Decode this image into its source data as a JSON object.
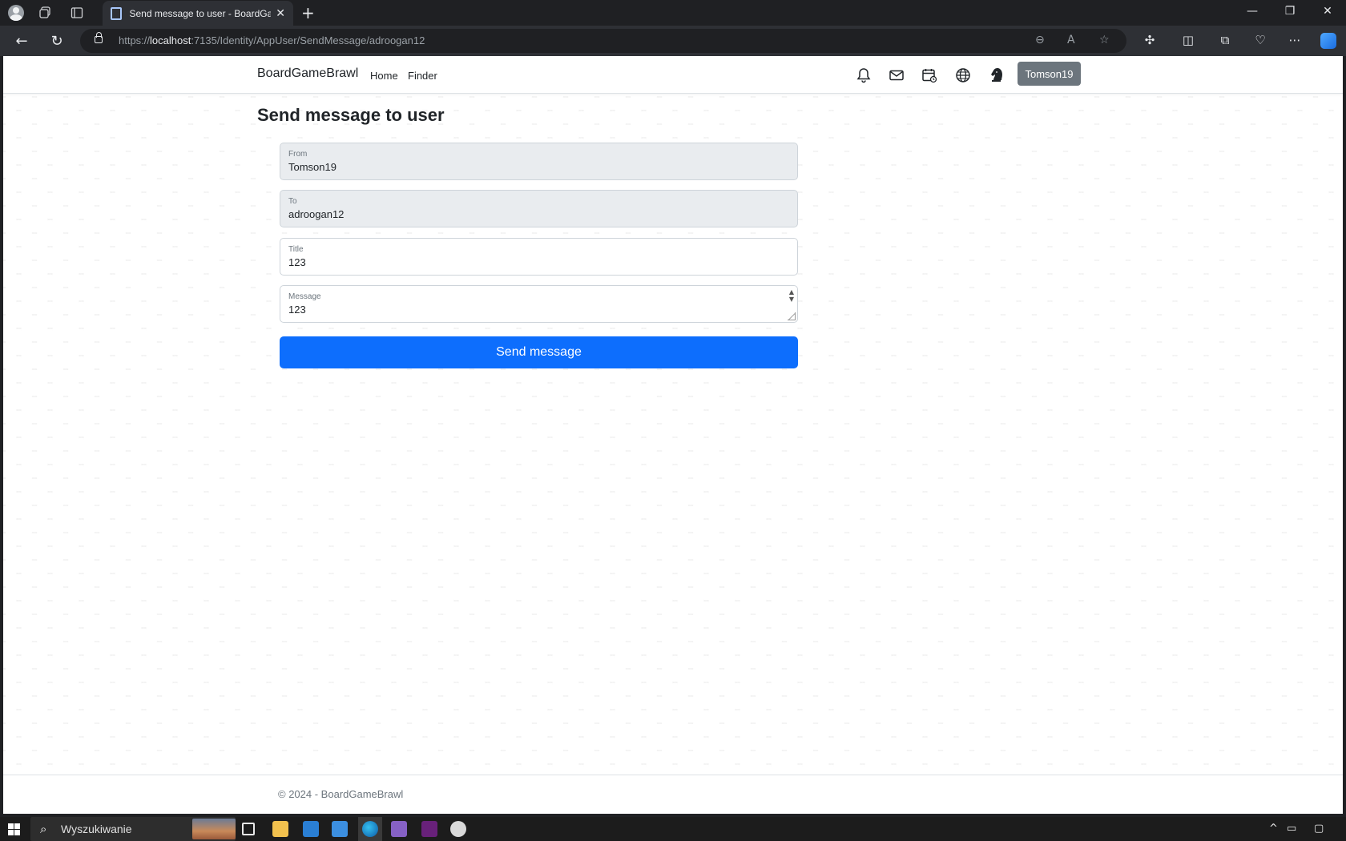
{
  "browser": {
    "tab_title": "Send message to user - BoardGa",
    "url_prefix": "https://",
    "url_host": "localhost",
    "url_rest": ":7135/Identity/AppUser/SendMessage/adroogan12"
  },
  "site": {
    "brand": "BoardGameBrawl",
    "nav": {
      "home": "Home",
      "finder": "Finder"
    },
    "user_button": "Tomson19",
    "icons": [
      "bell-icon",
      "envelope-icon",
      "calendar-icon",
      "globe-icon",
      "chess-knight-icon"
    ]
  },
  "page": {
    "title": "Send message to user",
    "fields": {
      "from": {
        "label": "From",
        "value": "Tomson19"
      },
      "to": {
        "label": "To",
        "value": "adroogan12"
      },
      "title": {
        "label": "Title",
        "value": "123"
      },
      "message": {
        "label": "Message",
        "value": "123"
      }
    },
    "submit_label": "Send message"
  },
  "footer": {
    "text": "© 2024 - BoardGameBrawl"
  },
  "taskbar": {
    "search_text": "Wyszukiwanie"
  }
}
